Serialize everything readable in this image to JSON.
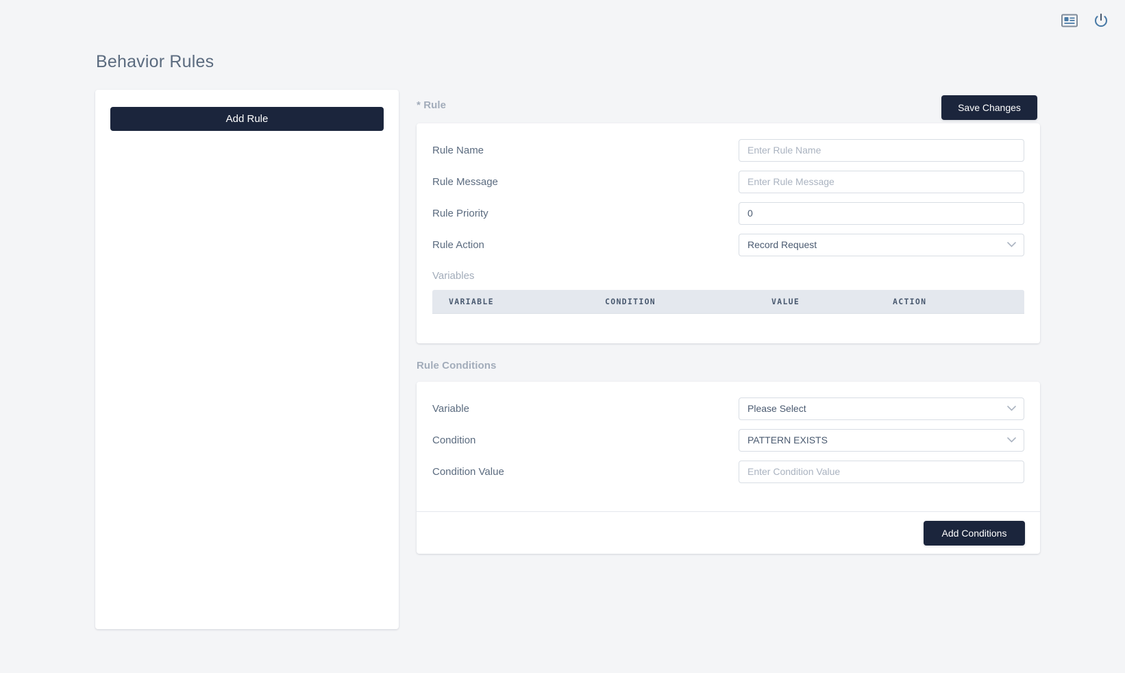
{
  "topbar": {
    "icons": [
      {
        "name": "id-card-icon",
        "label": "ID Card"
      },
      {
        "name": "power-icon",
        "label": "Power / Logout"
      }
    ]
  },
  "page": {
    "title": "Behavior Rules"
  },
  "left_panel": {
    "add_rule_label": "Add Rule"
  },
  "rule_section": {
    "label": "* Rule",
    "save_label": "Save Changes",
    "fields": [
      {
        "label": "Rule Name",
        "placeholder": "Enter Rule Name",
        "value": "",
        "type": "text"
      },
      {
        "label": "Rule Message",
        "placeholder": "Enter Rule Message",
        "value": "",
        "type": "text"
      },
      {
        "label": "Rule Priority",
        "placeholder": "",
        "value": "0",
        "type": "text"
      },
      {
        "label": "Rule Action",
        "placeholder": "",
        "value": "Record Request",
        "type": "select"
      }
    ],
    "variables": {
      "label": "Variables",
      "columns": [
        "VARIABLE",
        "CONDITION",
        "VALUE",
        "ACTION"
      ],
      "rows": []
    }
  },
  "conditions_section": {
    "label": "Rule Conditions",
    "fields": [
      {
        "label": "Variable",
        "placeholder": "",
        "value": "Please Select",
        "type": "select"
      },
      {
        "label": "Condition",
        "placeholder": "",
        "value": "PATTERN EXISTS",
        "type": "select"
      },
      {
        "label": "Condition Value",
        "placeholder": "Enter Condition Value",
        "value": "",
        "type": "text"
      }
    ],
    "add_conditions_label": "Add Conditions"
  },
  "colors": {
    "accent_dark": "#1b253c",
    "page_bg": "#f4f5f7",
    "card_bg": "#ffffff",
    "label_text": "#5b6b7f",
    "muted_text": "#a2acba",
    "table_header_bg": "#e4e8ee",
    "icon_blue": "#4a7ba7"
  }
}
